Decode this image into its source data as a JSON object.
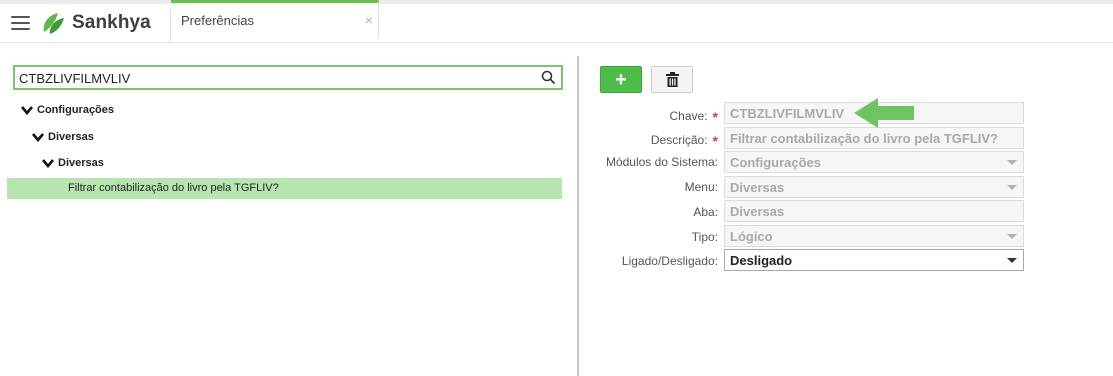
{
  "app": {
    "brand": "Sankhya",
    "tab": {
      "label": "Preferências",
      "close": "×"
    }
  },
  "search": {
    "value": "CTBZLIVFILMVLIV"
  },
  "tree": {
    "nodes": [
      {
        "label": "Configurações"
      },
      {
        "label": "Diversas"
      },
      {
        "label": "Diversas"
      }
    ],
    "leaf": "Filtrar contabilização do livro pela TGFLIV?"
  },
  "form": {
    "add_button": "+",
    "fields": [
      {
        "label": "Chave:",
        "required": "*",
        "value": "CTBZLIVFILMVLIV"
      },
      {
        "label": "Descrição:",
        "required": "*",
        "value": "Filtrar contabilização do livro pela TGFLIV?"
      },
      {
        "label": "Módulos do Sistema:",
        "value": "Configurações"
      },
      {
        "label": "Menu:",
        "value": "Diversas"
      },
      {
        "label": "Aba:",
        "value": "Diversas"
      },
      {
        "label": "Tipo:",
        "value": "Lógico"
      },
      {
        "label": "Ligado/Desligado:",
        "value": "Desligado"
      }
    ]
  },
  "colors": {
    "brand_green": "#4ebd4a",
    "selection_green": "#b7e5b0",
    "required_red": "#e03b3b",
    "arrow_green": "#6cc55e"
  }
}
